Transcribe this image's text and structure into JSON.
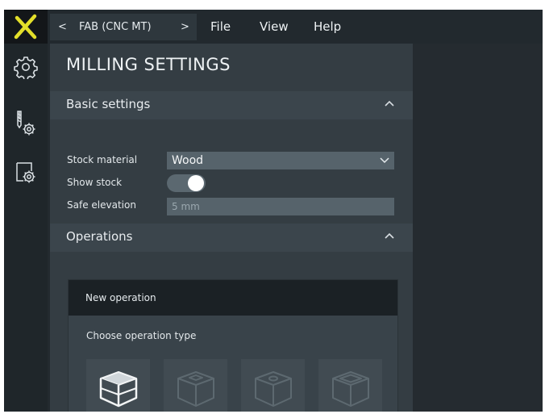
{
  "breadcrumb": {
    "back_glyph": "<",
    "label": "FAB (CNC MT)",
    "forward_glyph": ">"
  },
  "menu": [
    "File",
    "View",
    "Help"
  ],
  "rail": [
    {
      "icon": "gear-icon"
    },
    {
      "icon": "tool-settings-icon"
    },
    {
      "icon": "document-settings-icon"
    }
  ],
  "panel": {
    "title": "MILLING SETTINGS",
    "basic": {
      "title": "Basic settings",
      "stock_material_label": "Stock material",
      "stock_material_value": "Wood",
      "show_stock_label": "Show stock",
      "show_stock_on": true,
      "safe_elevation_label": "Safe elevation",
      "safe_elevation_placeholder": "5 mm"
    },
    "operations": {
      "title": "Operations",
      "card_title": "New operation",
      "choose_label": "Choose operation type",
      "types": [
        {
          "icon": "operation-cube-icon",
          "enabled": true
        },
        {
          "icon": "operation-pocket-icon",
          "enabled": false
        },
        {
          "icon": "operation-drill-icon",
          "enabled": false
        },
        {
          "icon": "operation-contour-icon",
          "enabled": false
        }
      ]
    }
  },
  "colors": {
    "logo_accent": "#e3df2a",
    "panel_bg": "#343d43",
    "header_bg": "#3b454c",
    "input_bg": "#56636b"
  }
}
